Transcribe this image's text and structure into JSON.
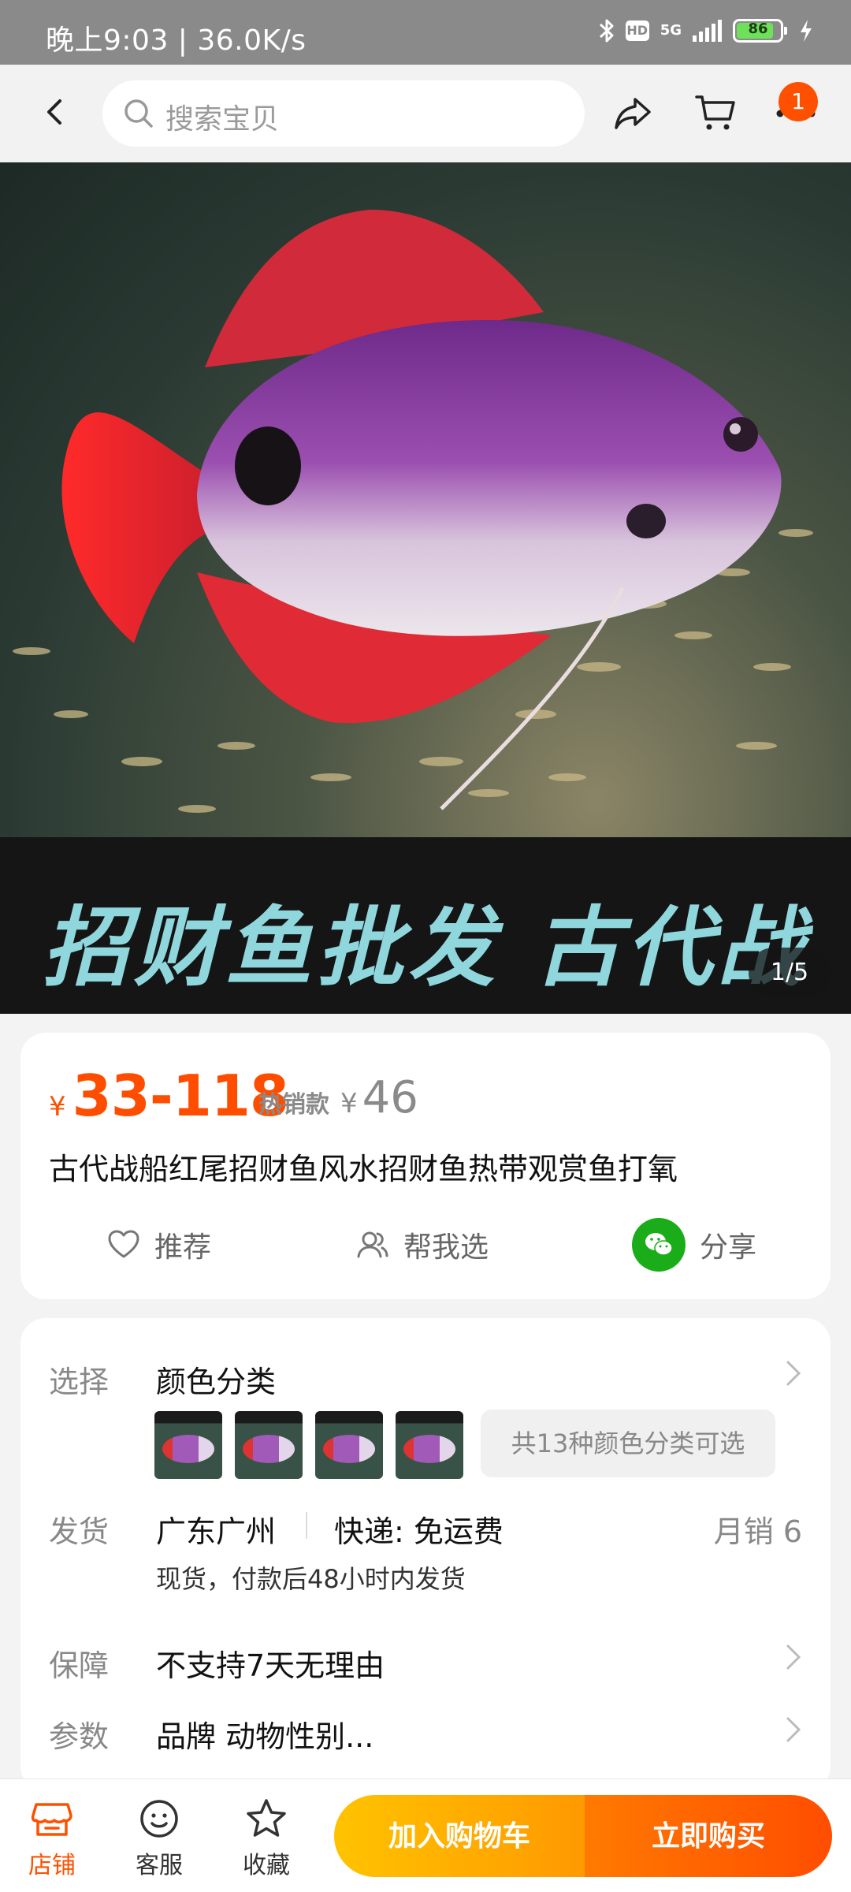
{
  "status_bar": {
    "time": "晚上9:03 | 36.0K/s",
    "network": "5G",
    "hd": "HD",
    "battery": "86"
  },
  "top_nav": {
    "search_placeholder": "搜索宝贝",
    "cart_badge": "1"
  },
  "gallery": {
    "banner_text": "招财鱼批发  古代战船",
    "counter": "1/5"
  },
  "product": {
    "price_symbol": "¥",
    "price": "33-118",
    "hot_label": "热销款",
    "hot_price_symbol": "¥",
    "hot_price": "46",
    "title": "古代战船红尾招财鱼风水招财鱼热带观赏鱼打氧",
    "actions": {
      "recommend": "推荐",
      "help_choose": "帮我选",
      "share": "分享"
    }
  },
  "details": {
    "select": {
      "label": "选择",
      "value": "颜色分类",
      "more_options": "共13种颜色分类可选"
    },
    "shipping": {
      "label": "发货",
      "origin": "广东广州",
      "express": "快递:  免运费",
      "monthly_sales": "月销  6",
      "note": "现货，付款后48小时内发货"
    },
    "guarantee": {
      "label": "保障",
      "value": "不支持7天无理由"
    },
    "params": {
      "label": "参数",
      "value": "品牌 动物性别..."
    }
  },
  "bottom_bar": {
    "store": "店铺",
    "service": "客服",
    "favorite": "收藏",
    "add_to_cart": "加入购物车",
    "buy_now": "立即购买"
  }
}
